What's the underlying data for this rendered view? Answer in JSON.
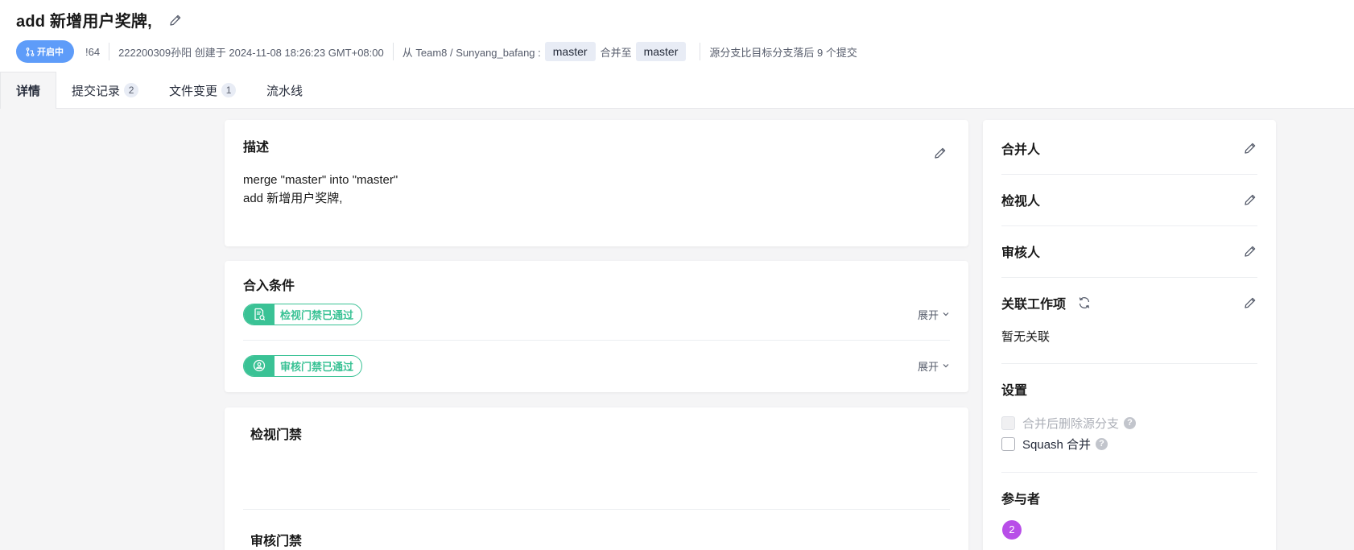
{
  "header": {
    "title": "add 新增用户奖牌,",
    "status": "开启中",
    "id": "!64",
    "author_info": "222200309孙阳 创建于 2024-11-08 18:26:23 GMT+08:00",
    "from_prefix": "从 Team8 / Sunyang_bafang :",
    "source_branch": "master",
    "merge_to": "合并至",
    "target_branch": "master",
    "behind_info": "源分支比目标分支落后 9 个提交"
  },
  "tabs": [
    {
      "label": "详情",
      "count": ""
    },
    {
      "label": "提交记录",
      "count": "2"
    },
    {
      "label": "文件变更",
      "count": "1"
    },
    {
      "label": "流水线",
      "count": ""
    }
  ],
  "description": {
    "title": "描述",
    "lines": [
      "merge \"master\" into \"master\"",
      "add 新增用户奖牌,"
    ]
  },
  "conditions": {
    "title": "合入条件",
    "items": [
      {
        "label": "检视门禁已通过",
        "expand": "展开"
      },
      {
        "label": "审核门禁已通过",
        "expand": "展开"
      }
    ]
  },
  "gates": {
    "review_title": "检视门禁",
    "approve_title": "审核门禁"
  },
  "sidebar": {
    "merger": "合并人",
    "reviewer": "检视人",
    "approver": "审核人",
    "linked_items": "关联工作项",
    "linked_empty": "暂无关联",
    "settings": "设置",
    "delete_branch": "合并后删除源分支",
    "squash": "Squash 合并",
    "participants": "参与者",
    "participant_count": "2"
  },
  "colors": {
    "status_blue": "#5e9cf9",
    "pass_green": "#3ac295",
    "avatar_purple": "#b84ee8"
  }
}
